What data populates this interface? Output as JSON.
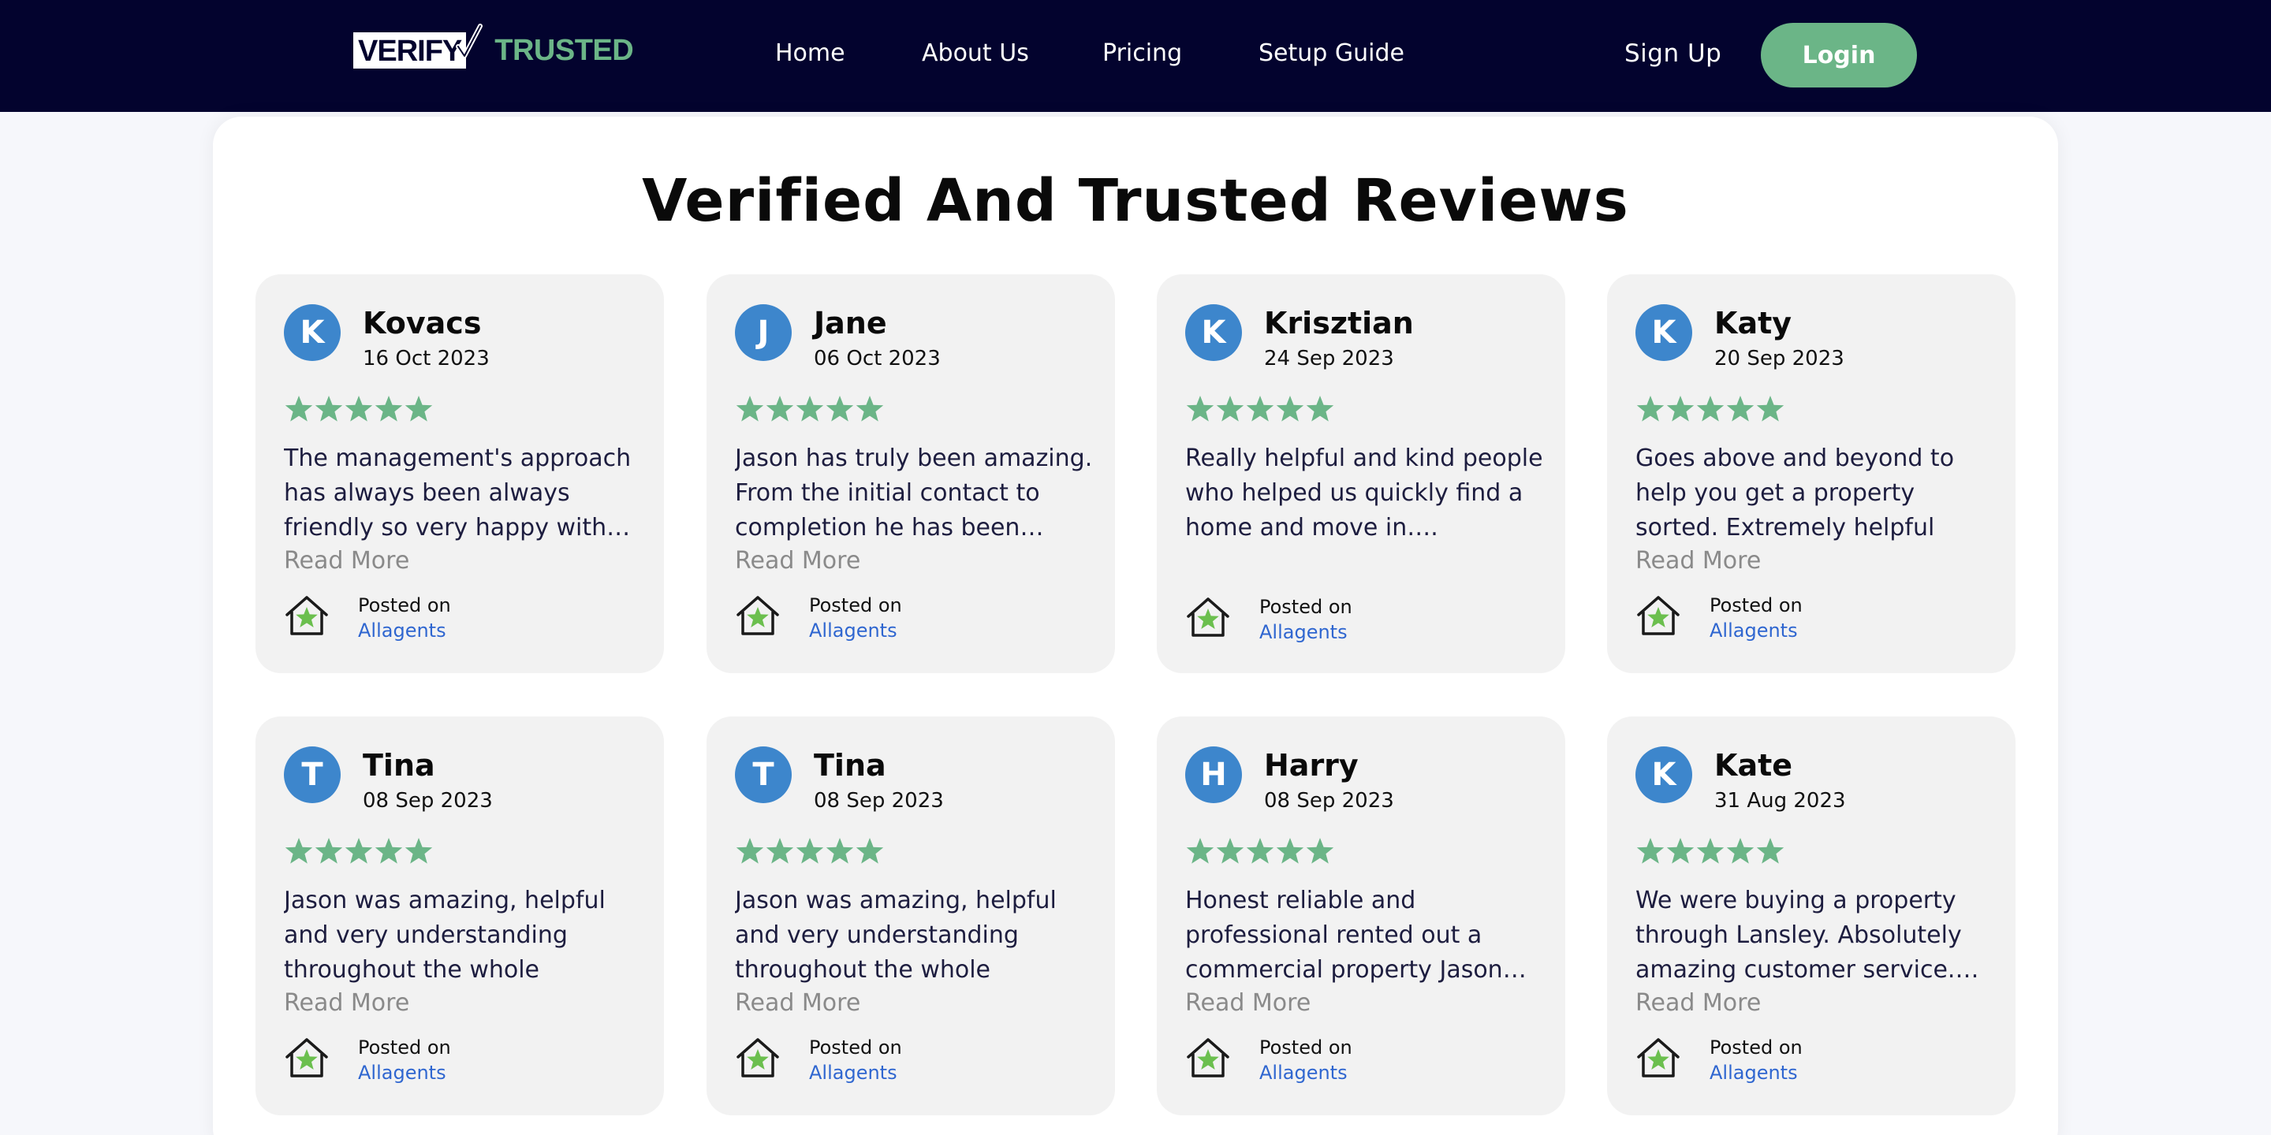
{
  "nav": {
    "logo_part1": "VERIFY",
    "logo_part2": "TRUSTED",
    "links": [
      "Home",
      "About Us",
      "Pricing",
      "Setup Guide"
    ],
    "signup": "Sign Up",
    "login": "Login"
  },
  "page": {
    "title": "Verified And Trusted Reviews"
  },
  "reviews": [
    {
      "initial": "K",
      "name": "Kovacs",
      "date": "16 Oct 2023",
      "rating": 5,
      "text": "The management's approach has always been always friendly so very happy with…",
      "read_more": "Read More",
      "posted_on": "Posted on",
      "platform": "Allagents"
    },
    {
      "initial": "J",
      "name": "Jane",
      "date": "06 Oct 2023",
      "rating": 5,
      "text": "Jason has truly been amazing. From the initial contact to completion he has been…",
      "read_more": "Read More",
      "posted_on": "Posted on",
      "platform": "Allagents"
    },
    {
      "initial": "K",
      "name": "Krisztian",
      "date": "24 Sep 2023",
      "rating": 5,
      "text": "Really helpful and kind people who helped us quickly find a home and move in….",
      "read_more": "",
      "posted_on": "Posted on",
      "platform": "Allagents"
    },
    {
      "initial": "K",
      "name": "Katy",
      "date": "20 Sep 2023",
      "rating": 5,
      "text": "Goes above and beyond to help you get a property sorted. Extremely helpful and…",
      "read_more": "Read More",
      "posted_on": "Posted on",
      "platform": "Allagents"
    },
    {
      "initial": "T",
      "name": "Tina",
      "date": "08 Sep 2023",
      "rating": 5,
      "text": "Jason was amazing, helpful and very understanding throughout the whole proces…",
      "read_more": "Read More",
      "posted_on": "Posted on",
      "platform": "Allagents"
    },
    {
      "initial": "T",
      "name": "Tina",
      "date": "08 Sep 2023",
      "rating": 5,
      "text": "Jason was amazing, helpful and very understanding throughout the whole proces…",
      "read_more": "Read More",
      "posted_on": "Posted on",
      "platform": "Allagents"
    },
    {
      "initial": "H",
      "name": "Harry",
      "date": "08 Sep 2023",
      "rating": 5,
      "text": "Honest reliable and professional rented out a commercial property Jason…",
      "read_more": "Read More",
      "posted_on": "Posted on",
      "platform": "Allagents"
    },
    {
      "initial": "K",
      "name": "Kate",
      "date": "31 Aug 2023",
      "rating": 5,
      "text": "We were buying a property through Lansley. Absolutely amazing customer service.…",
      "read_more": "Read More",
      "posted_on": "Posted on",
      "platform": "Allagents"
    }
  ],
  "colors": {
    "navbar_bg": "#03032e",
    "accent_green": "#6bb587",
    "avatar_blue": "#3d86cc",
    "link_blue": "#2f66d0",
    "star_green": "#6bb587"
  },
  "icons": {
    "star": "star-icon",
    "platform": "house-star-icon",
    "logo_check": "checkmark-icon"
  }
}
